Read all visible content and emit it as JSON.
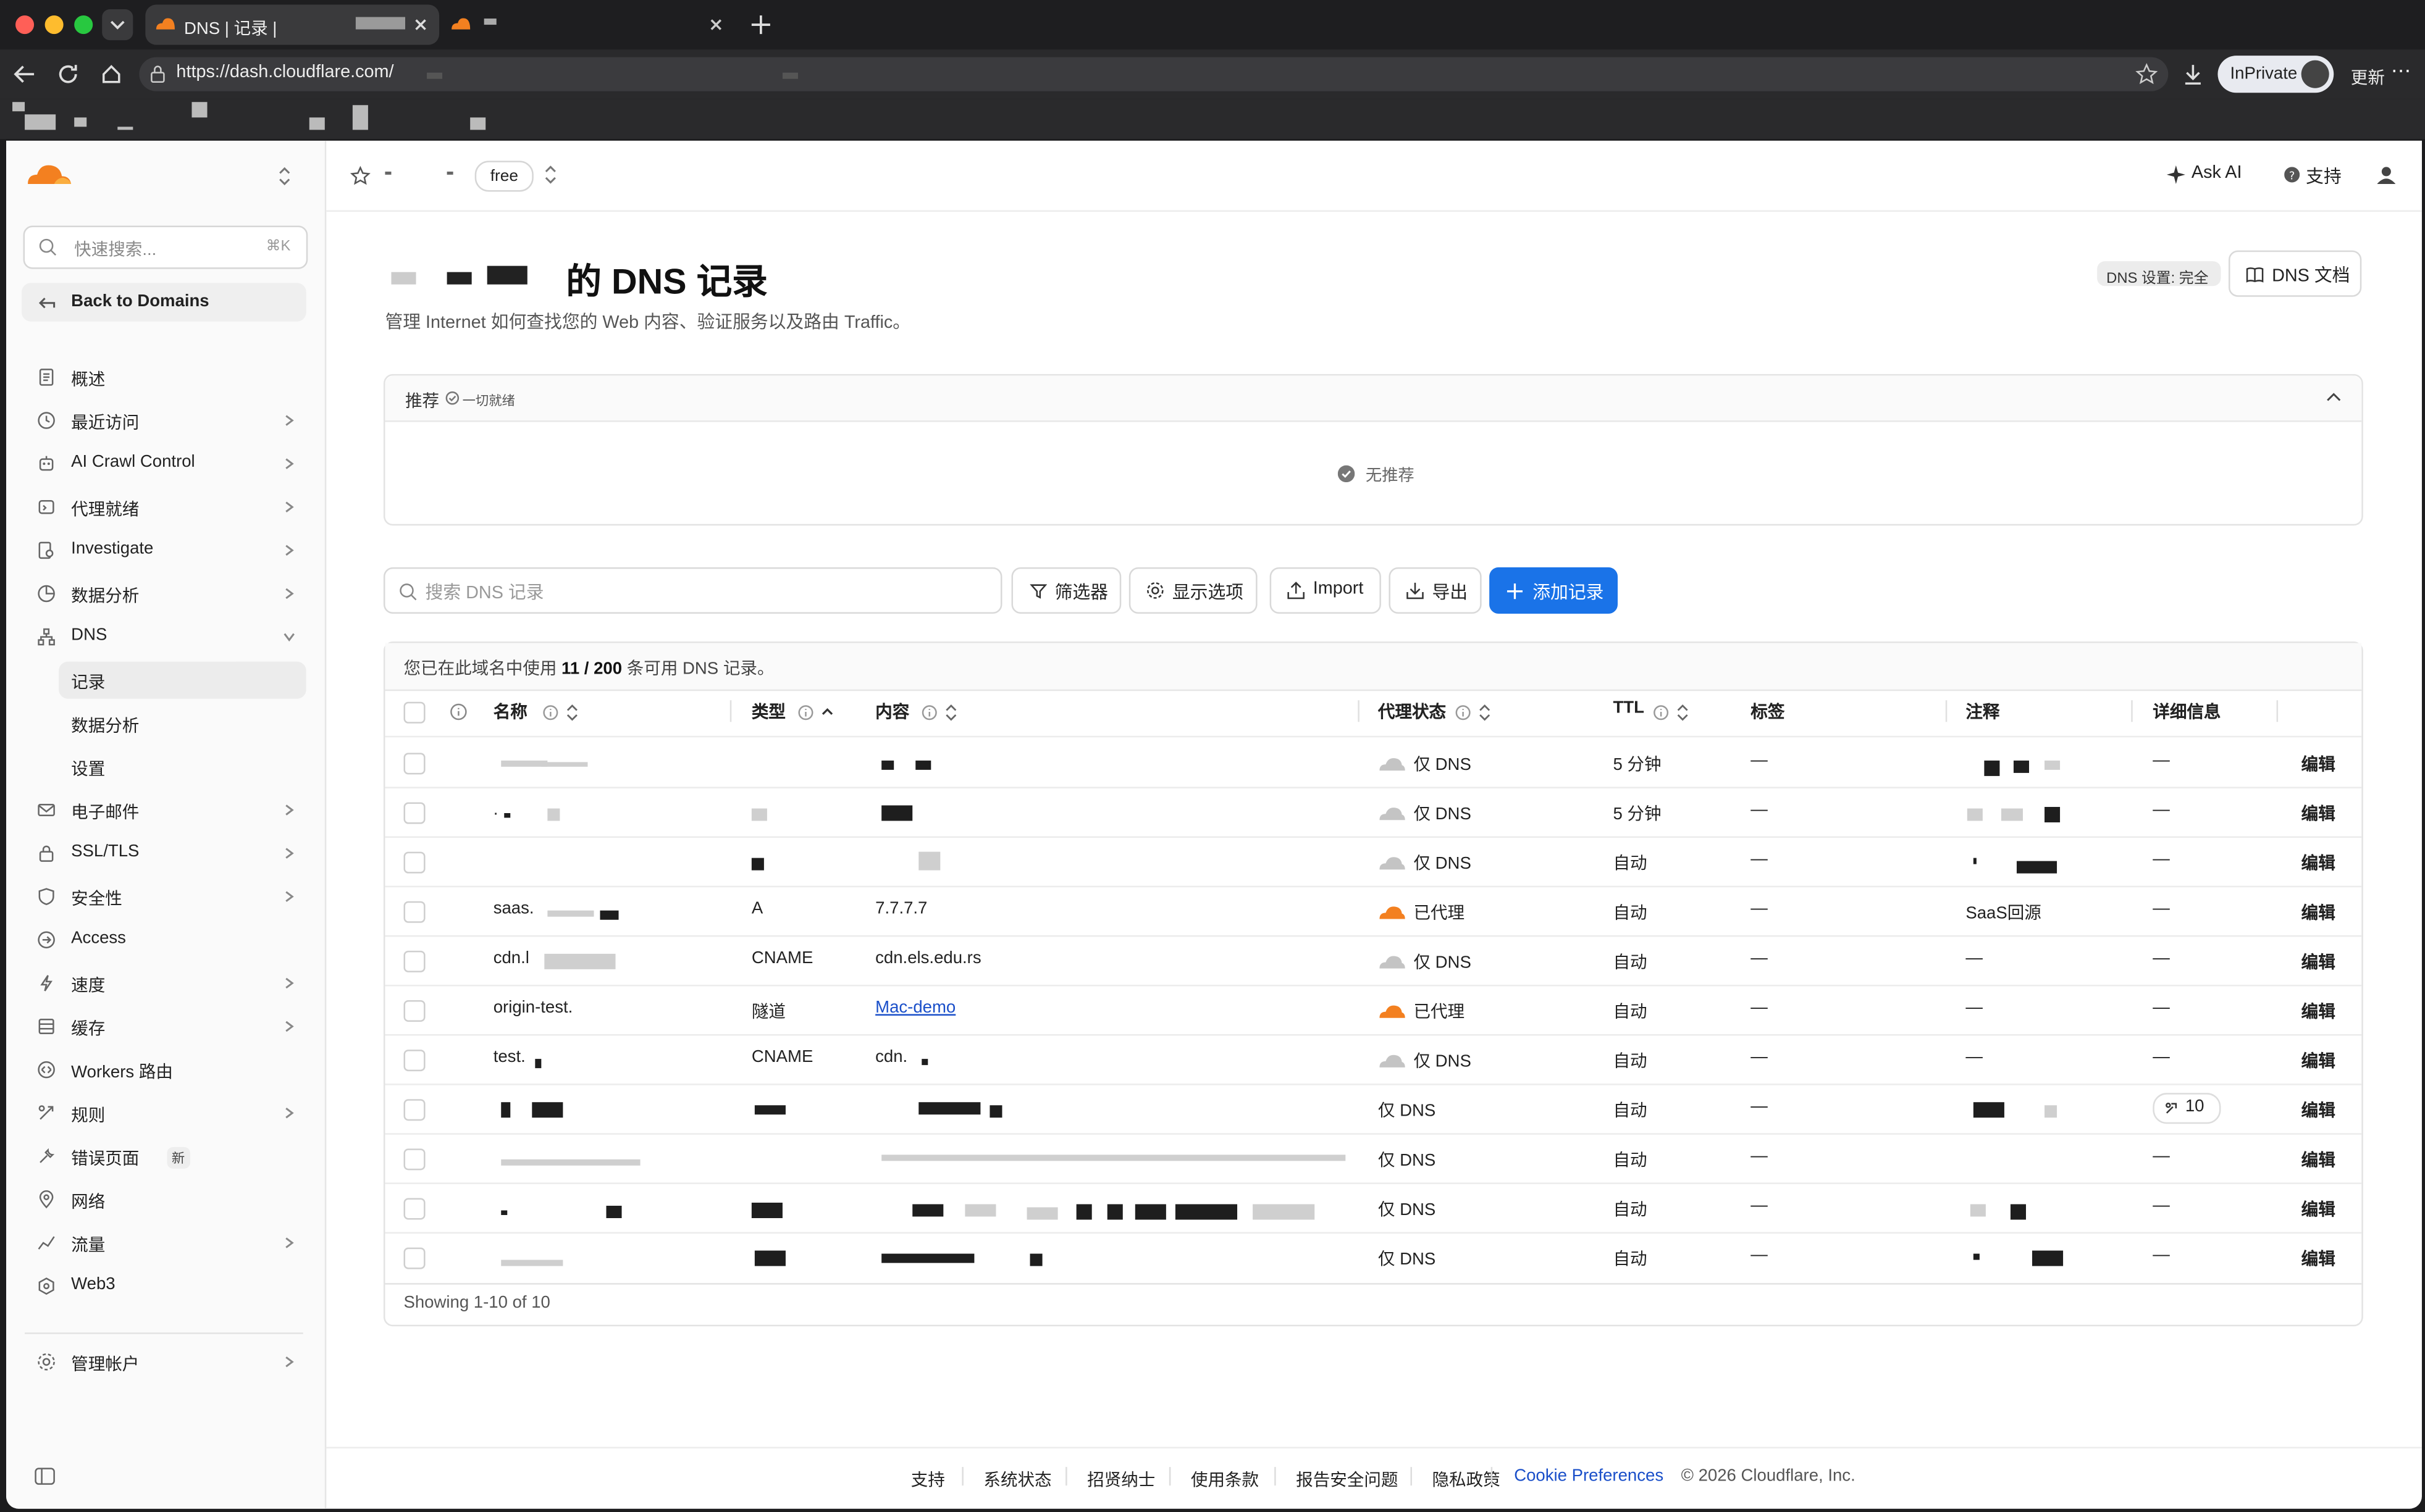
{
  "browser": {
    "tab_title": "DNS | 记录 |",
    "url": "https://dash.cloudflare.com/",
    "profile_label": "InPrivate",
    "update_label": "更新"
  },
  "header": {
    "plan_badge": "free",
    "ask_ai": "Ask AI",
    "support": "支持"
  },
  "sidebar": {
    "search_placeholder": "快速搜索...",
    "search_shortcut": "⌘K",
    "back_label": "Back to Domains",
    "items": [
      {
        "label": "概述",
        "icon": "document-icon",
        "chevron": false
      },
      {
        "label": "最近访问",
        "icon": "clock-icon",
        "chevron": true
      },
      {
        "label": "AI Crawl Control",
        "icon": "robot-icon",
        "chevron": true
      },
      {
        "label": "代理就绪",
        "icon": "agent-icon",
        "chevron": true
      },
      {
        "label": "Investigate",
        "icon": "magnify-doc-icon",
        "chevron": true
      },
      {
        "label": "数据分析",
        "icon": "chart-icon",
        "chevron": true
      },
      {
        "label": "DNS",
        "icon": "network-icon",
        "chevron": true
      },
      {
        "label": "记录",
        "sub": true,
        "active": true
      },
      {
        "label": "数据分析",
        "sub": true
      },
      {
        "label": "设置",
        "sub": true
      },
      {
        "label": "电子邮件",
        "icon": "mail-icon",
        "chevron": true
      },
      {
        "label": "SSL/TLS",
        "icon": "lock-icon",
        "chevron": true
      },
      {
        "label": "安全性",
        "icon": "shield-icon",
        "chevron": true
      },
      {
        "label": "Access",
        "icon": "access-icon",
        "chevron": false
      },
      {
        "label": "速度",
        "icon": "bolt-icon",
        "chevron": true
      },
      {
        "label": "缓存",
        "icon": "cache-icon",
        "chevron": true
      },
      {
        "label": "Workers 路由",
        "icon": "workers-icon",
        "chevron": false
      },
      {
        "label": "规则",
        "icon": "rules-icon",
        "chevron": true
      },
      {
        "label": "错误页面",
        "icon": "wrench-icon",
        "chevron": false,
        "badge": "新"
      },
      {
        "label": "网络",
        "icon": "pin-icon",
        "chevron": false
      },
      {
        "label": "流量",
        "icon": "traffic-icon",
        "chevron": true
      },
      {
        "label": "Web3",
        "icon": "web3-icon",
        "chevron": false
      }
    ],
    "manage_account": "管理帐户"
  },
  "main": {
    "title_suffix": "的 DNS 记录",
    "subtitle": "管理 Internet 如何查找您的 Web 内容、验证服务以及路由 Traffic。",
    "dns_setup_badge": "DNS 设置: 完全",
    "dns_docs": "DNS 文档",
    "recommend_title": "推荐",
    "recommend_status": "一切就绪",
    "recommend_empty": "无推荐",
    "search_placeholder": "搜索 DNS 记录",
    "filter_btn": "筛选器",
    "display_btn": "显示选项",
    "import_btn": "Import",
    "export_btn": "导出",
    "add_btn": "添加记录",
    "usage_prefix": "您已在此域名中使用",
    "usage_count": "11 / 200",
    "usage_suffix": "条可用 DNS 记录。",
    "columns": [
      "名称",
      "类型",
      "内容",
      "代理状态",
      "TTL",
      "标签",
      "注释",
      "详细信息"
    ],
    "rows": [
      {
        "name": "",
        "type": "",
        "content": "",
        "proxy": "仅 DNS",
        "cloud": "grey",
        "ttl": "5 分钟",
        "tags": "—",
        "comment": "",
        "details": "—"
      },
      {
        "name": ".",
        "type": "",
        "content": "",
        "proxy": "仅 DNS",
        "cloud": "grey",
        "ttl": "5 分钟",
        "tags": "—",
        "comment": "",
        "details": "—"
      },
      {
        "name": "",
        "type": "",
        "content": "",
        "proxy": "仅 DNS",
        "cloud": "grey",
        "ttl": "自动",
        "tags": "—",
        "comment": "",
        "details": "—"
      },
      {
        "name": "saas.",
        "type": "A",
        "content": "7.7.7.7",
        "proxy": "已代理",
        "cloud": "orange",
        "ttl": "自动",
        "tags": "—",
        "comment": "SaaS回源",
        "details": "—"
      },
      {
        "name": "cdn.l",
        "type": "CNAME",
        "content": "cdn.els.edu.rs",
        "proxy": "仅 DNS",
        "cloud": "grey",
        "ttl": "自动",
        "tags": "—",
        "comment": "—",
        "details": "—"
      },
      {
        "name": "origin-test.",
        "type": "隧道",
        "content": "Mac-demo",
        "link": true,
        "proxy": "已代理",
        "cloud": "orange",
        "ttl": "自动",
        "tags": "—",
        "comment": "—",
        "details": "—"
      },
      {
        "name": "test.",
        "type": "CNAME",
        "content": "cdn.",
        "proxy": "仅 DNS",
        "cloud": "grey",
        "ttl": "自动",
        "tags": "—",
        "comment": "—",
        "details": "—"
      },
      {
        "name": "",
        "type": "",
        "content": "",
        "proxy": "仅 DNS",
        "cloud": "none",
        "ttl": "自动",
        "tags": "—",
        "comment": "",
        "details": "10"
      },
      {
        "name": "",
        "type": "",
        "content": "",
        "proxy": "仅 DNS",
        "cloud": "none",
        "ttl": "自动",
        "tags": "—",
        "comment": "",
        "details": "—"
      },
      {
        "name": "",
        "type": "",
        "content": "",
        "proxy": "仅 DNS",
        "cloud": "none",
        "ttl": "自动",
        "tags": "—",
        "comment": "",
        "details": "—"
      },
      {
        "name": "",
        "type": "",
        "content": "",
        "proxy": "仅 DNS",
        "cloud": "none",
        "ttl": "自动",
        "tags": "—",
        "comment": "",
        "details": "—"
      }
    ],
    "edit_label": "编辑",
    "showing": "Showing 1-10 of 10"
  },
  "footer": {
    "links": [
      "支持",
      "系统状态",
      "招贤纳士",
      "使用条款",
      "报告安全问题",
      "隐私政策"
    ],
    "cookie": "Cookie Preferences",
    "copyright": "© 2026 Cloudflare, Inc."
  },
  "colors": {
    "accent": "#1a73e8",
    "cloud_orange": "#f38020",
    "link": "#1a4fc9"
  }
}
